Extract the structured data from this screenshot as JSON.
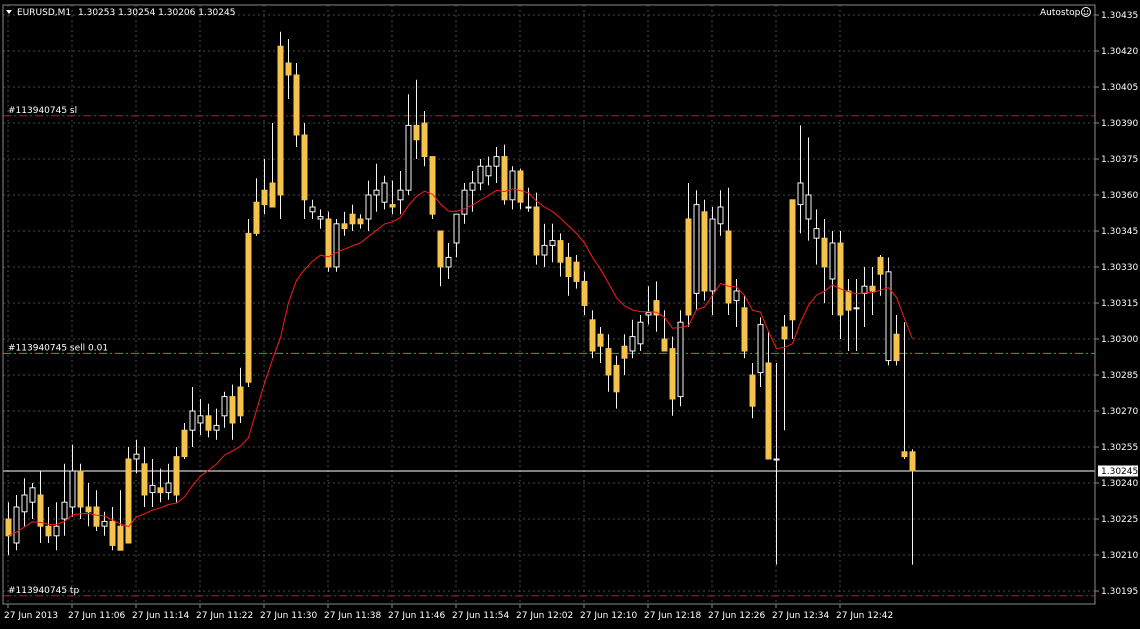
{
  "header": {
    "symbol": "EURUSD,M1",
    "ohlc": "1.30253 1.30254 1.30206 1.30245",
    "autostop_label": "Autostop",
    "autostop_icon": "smiley-icon"
  },
  "colors": {
    "background": "#000000",
    "grid": "#4a4a4a",
    "axis_text": "#ffffff",
    "bull_fill": "#000000",
    "bear_fill": "#f3c34c",
    "candle_outline": "#f4f4f4",
    "ma_line": "#ff1a1a",
    "order_line_sl_tp": "#c8102e",
    "order_line_entry": "#27b24a",
    "price_tag_bg": "#ffffff",
    "price_tag_text": "#000000"
  },
  "chart_data": {
    "type": "candlestick",
    "ylim": [
      1.3019,
      1.3044
    ],
    "y_ticks": [
      "1.30435",
      "1.30420",
      "1.30405",
      "1.30390",
      "1.30375",
      "1.30360",
      "1.30345",
      "1.30330",
      "1.30315",
      "1.30300",
      "1.30285",
      "1.30270",
      "1.30255",
      "1.30240",
      "1.30225",
      "1.30210",
      "1.30195"
    ],
    "x_ticks": [
      "27 Jun 2013",
      "27 Jun 11:06",
      "27 Jun 11:14",
      "27 Jun 11:22",
      "27 Jun 11:30",
      "27 Jun 11:38",
      "27 Jun 11:46",
      "27 Jun 11:54",
      "27 Jun 12:02",
      "27 Jun 12:10",
      "27 Jun 12:18",
      "27 Jun 12:26",
      "27 Jun 12:34",
      "27 Jun 12:42"
    ],
    "current_price": "1.30245",
    "order_lines": [
      {
        "label": "#113940745 sl",
        "price": 1.30393,
        "kind": "sl"
      },
      {
        "label": "#113940745 sell 0.01",
        "price": 1.30294,
        "kind": "entry"
      },
      {
        "label": "#113940745 tp",
        "price": 1.30193,
        "kind": "tp"
      }
    ],
    "candles": [
      {
        "o": 1.30225,
        "h": 1.30232,
        "l": 1.3021,
        "c": 1.30218
      },
      {
        "o": 1.30215,
        "h": 1.30235,
        "l": 1.30212,
        "c": 1.3023
      },
      {
        "o": 1.30228,
        "h": 1.30242,
        "l": 1.30222,
        "c": 1.30235
      },
      {
        "o": 1.30232,
        "h": 1.3024,
        "l": 1.30225,
        "c": 1.30238
      },
      {
        "o": 1.30235,
        "h": 1.30245,
        "l": 1.30215,
        "c": 1.30222
      },
      {
        "o": 1.30222,
        "h": 1.3023,
        "l": 1.30215,
        "c": 1.30218
      },
      {
        "o": 1.30218,
        "h": 1.30232,
        "l": 1.30212,
        "c": 1.30222
      },
      {
        "o": 1.30225,
        "h": 1.30248,
        "l": 1.30218,
        "c": 1.30232
      },
      {
        "o": 1.3023,
        "h": 1.30256,
        "l": 1.30226,
        "c": 1.30245
      },
      {
        "o": 1.30245,
        "h": 1.30248,
        "l": 1.30225,
        "c": 1.3023
      },
      {
        "o": 1.3023,
        "h": 1.3024,
        "l": 1.30222,
        "c": 1.30228
      },
      {
        "o": 1.3023,
        "h": 1.30237,
        "l": 1.3022,
        "c": 1.30222
      },
      {
        "o": 1.30222,
        "h": 1.30228,
        "l": 1.30218,
        "c": 1.30224
      },
      {
        "o": 1.30224,
        "h": 1.3023,
        "l": 1.30212,
        "c": 1.30214
      },
      {
        "o": 1.30222,
        "h": 1.30237,
        "l": 1.30212,
        "c": 1.30212
      },
      {
        "o": 1.3025,
        "h": 1.30255,
        "l": 1.30215,
        "c": 1.30215
      },
      {
        "o": 1.3025,
        "h": 1.30258,
        "l": 1.30244,
        "c": 1.30252
      },
      {
        "o": 1.30248,
        "h": 1.30255,
        "l": 1.3023,
        "c": 1.30235
      },
      {
        "o": 1.30236,
        "h": 1.3025,
        "l": 1.3023,
        "c": 1.30239
      },
      {
        "o": 1.30238,
        "h": 1.30246,
        "l": 1.30232,
        "c": 1.30236
      },
      {
        "o": 1.30236,
        "h": 1.30248,
        "l": 1.30233,
        "c": 1.3024
      },
      {
        "o": 1.30251,
        "h": 1.30255,
        "l": 1.30232,
        "c": 1.30235
      },
      {
        "o": 1.30262,
        "h": 1.30265,
        "l": 1.3025,
        "c": 1.30251
      },
      {
        "o": 1.30262,
        "h": 1.3028,
        "l": 1.30255,
        "c": 1.3027
      },
      {
        "o": 1.30265,
        "h": 1.30275,
        "l": 1.3026,
        "c": 1.30268
      },
      {
        "o": 1.30268,
        "h": 1.30273,
        "l": 1.30259,
        "c": 1.30262
      },
      {
        "o": 1.30262,
        "h": 1.30271,
        "l": 1.30258,
        "c": 1.30264
      },
      {
        "o": 1.30268,
        "h": 1.30278,
        "l": 1.30263,
        "c": 1.30276
      },
      {
        "o": 1.30276,
        "h": 1.30281,
        "l": 1.30258,
        "c": 1.30265
      },
      {
        "o": 1.3028,
        "h": 1.30288,
        "l": 1.30265,
        "c": 1.30268
      },
      {
        "o": 1.30344,
        "h": 1.3035,
        "l": 1.3028,
        "c": 1.30282
      },
      {
        "o": 1.30357,
        "h": 1.30367,
        "l": 1.30343,
        "c": 1.30344
      },
      {
        "o": 1.30362,
        "h": 1.30375,
        "l": 1.30352,
        "c": 1.30356
      },
      {
        "o": 1.30365,
        "h": 1.3039,
        "l": 1.30355,
        "c": 1.30355
      },
      {
        "o": 1.30422,
        "h": 1.30428,
        "l": 1.3035,
        "c": 1.3036
      },
      {
        "o": 1.30415,
        "h": 1.30425,
        "l": 1.304,
        "c": 1.3041
      },
      {
        "o": 1.3041,
        "h": 1.30415,
        "l": 1.3038,
        "c": 1.30385
      },
      {
        "o": 1.30385,
        "h": 1.3039,
        "l": 1.3035,
        "c": 1.30358
      },
      {
        "o": 1.30353,
        "h": 1.30358,
        "l": 1.3035,
        "c": 1.30355
      },
      {
        "o": 1.3035,
        "h": 1.30354,
        "l": 1.30346,
        "c": 1.30351
      },
      {
        "o": 1.3035,
        "h": 1.30353,
        "l": 1.30328,
        "c": 1.3033
      },
      {
        "o": 1.3033,
        "h": 1.3035,
        "l": 1.30328,
        "c": 1.30348
      },
      {
        "o": 1.30348,
        "h": 1.30353,
        "l": 1.30343,
        "c": 1.30346
      },
      {
        "o": 1.30352,
        "h": 1.30356,
        "l": 1.30345,
        "c": 1.30348
      },
      {
        "o": 1.3035,
        "h": 1.30352,
        "l": 1.30346,
        "c": 1.30348
      },
      {
        "o": 1.3035,
        "h": 1.30366,
        "l": 1.30345,
        "c": 1.3036
      },
      {
        "o": 1.3036,
        "h": 1.30373,
        "l": 1.30353,
        "c": 1.30362
      },
      {
        "o": 1.30357,
        "h": 1.30368,
        "l": 1.30354,
        "c": 1.30365
      },
      {
        "o": 1.30356,
        "h": 1.30366,
        "l": 1.30352,
        "c": 1.30355
      },
      {
        "o": 1.30358,
        "h": 1.3037,
        "l": 1.30352,
        "c": 1.30362
      },
      {
        "o": 1.30362,
        "h": 1.30402,
        "l": 1.3036,
        "c": 1.30389
      },
      {
        "o": 1.30389,
        "h": 1.30408,
        "l": 1.30375,
        "c": 1.30383
      },
      {
        "o": 1.3039,
        "h": 1.30395,
        "l": 1.30372,
        "c": 1.30376
      },
      {
        "o": 1.30376,
        "h": 1.30376,
        "l": 1.3035,
        "c": 1.30352
      },
      {
        "o": 1.30345,
        "h": 1.30345,
        "l": 1.30322,
        "c": 1.3033
      },
      {
        "o": 1.3033,
        "h": 1.3034,
        "l": 1.30325,
        "c": 1.30334
      },
      {
        "o": 1.3034,
        "h": 1.30351,
        "l": 1.30334,
        "c": 1.30352
      },
      {
        "o": 1.30352,
        "h": 1.30365,
        "l": 1.30348,
        "c": 1.30362
      },
      {
        "o": 1.30362,
        "h": 1.3037,
        "l": 1.30353,
        "c": 1.30365
      },
      {
        "o": 1.30365,
        "h": 1.30375,
        "l": 1.30362,
        "c": 1.30372
      },
      {
        "o": 1.30368,
        "h": 1.30376,
        "l": 1.30364,
        "c": 1.30372
      },
      {
        "o": 1.30372,
        "h": 1.3038,
        "l": 1.30365,
        "c": 1.30376
      },
      {
        "o": 1.30376,
        "h": 1.30381,
        "l": 1.30356,
        "c": 1.30358
      },
      {
        "o": 1.30358,
        "h": 1.30372,
        "l": 1.30354,
        "c": 1.3037
      },
      {
        "o": 1.3037,
        "h": 1.30371,
        "l": 1.30354,
        "c": 1.30357
      },
      {
        "o": 1.30355,
        "h": 1.30363,
        "l": 1.30353,
        "c": 1.30355
      },
      {
        "o": 1.30355,
        "h": 1.30361,
        "l": 1.30331,
        "c": 1.30335
      },
      {
        "o": 1.30335,
        "h": 1.30348,
        "l": 1.3033,
        "c": 1.30339
      },
      {
        "o": 1.30339,
        "h": 1.30348,
        "l": 1.30332,
        "c": 1.30341
      },
      {
        "o": 1.30341,
        "h": 1.30344,
        "l": 1.30326,
        "c": 1.30332
      },
      {
        "o": 1.30334,
        "h": 1.3034,
        "l": 1.30318,
        "c": 1.30326
      },
      {
        "o": 1.30332,
        "h": 1.30335,
        "l": 1.30321,
        "c": 1.30324
      },
      {
        "o": 1.30324,
        "h": 1.30328,
        "l": 1.3031,
        "c": 1.30314
      },
      {
        "o": 1.30308,
        "h": 1.30312,
        "l": 1.30292,
        "c": 1.30295
      },
      {
        "o": 1.30302,
        "h": 1.30305,
        "l": 1.3029,
        "c": 1.30297
      },
      {
        "o": 1.30296,
        "h": 1.30302,
        "l": 1.30278,
        "c": 1.30285
      },
      {
        "o": 1.30289,
        "h": 1.30293,
        "l": 1.30271,
        "c": 1.30278
      },
      {
        "o": 1.30297,
        "h": 1.30302,
        "l": 1.30285,
        "c": 1.30292
      },
      {
        "o": 1.30295,
        "h": 1.30308,
        "l": 1.30292,
        "c": 1.30301
      },
      {
        "o": 1.30298,
        "h": 1.3031,
        "l": 1.30295,
        "c": 1.30307
      },
      {
        "o": 1.3031,
        "h": 1.30322,
        "l": 1.30306,
        "c": 1.30311
      },
      {
        "o": 1.30316,
        "h": 1.30324,
        "l": 1.30303,
        "c": 1.3031
      },
      {
        "o": 1.303,
        "h": 1.30312,
        "l": 1.30295,
        "c": 1.30295
      },
      {
        "o": 1.30296,
        "h": 1.30301,
        "l": 1.30268,
        "c": 1.30275
      },
      {
        "o": 1.30276,
        "h": 1.30312,
        "l": 1.30272,
        "c": 1.30307
      },
      {
        "o": 1.3035,
        "h": 1.30365,
        "l": 1.30305,
        "c": 1.3031
      },
      {
        "o": 1.30319,
        "h": 1.30362,
        "l": 1.30312,
        "c": 1.30356
      },
      {
        "o": 1.30353,
        "h": 1.30358,
        "l": 1.30316,
        "c": 1.3032
      },
      {
        "o": 1.3032,
        "h": 1.30355,
        "l": 1.3031,
        "c": 1.3035
      },
      {
        "o": 1.30348,
        "h": 1.30362,
        "l": 1.30343,
        "c": 1.30355
      },
      {
        "o": 1.30345,
        "h": 1.30363,
        "l": 1.3031,
        "c": 1.30315
      },
      {
        "o": 1.30316,
        "h": 1.30325,
        "l": 1.30305,
        "c": 1.3032
      },
      {
        "o": 1.30313,
        "h": 1.30318,
        "l": 1.30292,
        "c": 1.30295
      },
      {
        "o": 1.30285,
        "h": 1.3029,
        "l": 1.30267,
        "c": 1.30272
      },
      {
        "o": 1.30286,
        "h": 1.30309,
        "l": 1.3028,
        "c": 1.30306
      },
      {
        "o": 1.3029,
        "h": 1.30303,
        "l": 1.3025,
        "c": 1.3025
      },
      {
        "o": 1.3025,
        "h": 1.3029,
        "l": 1.30206,
        "c": 1.3025
      },
      {
        "o": 1.30305,
        "h": 1.3031,
        "l": 1.30262,
        "c": 1.303
      },
      {
        "o": 1.30358,
        "h": 1.30358,
        "l": 1.303,
        "c": 1.30308
      },
      {
        "o": 1.30356,
        "h": 1.30389,
        "l": 1.30344,
        "c": 1.30365
      },
      {
        "o": 1.3035,
        "h": 1.30384,
        "l": 1.30341,
        "c": 1.3036
      },
      {
        "o": 1.30342,
        "h": 1.30354,
        "l": 1.30331,
        "c": 1.30346
      },
      {
        "o": 1.30342,
        "h": 1.3035,
        "l": 1.30315,
        "c": 1.3033
      },
      {
        "o": 1.30325,
        "h": 1.30345,
        "l": 1.3031,
        "c": 1.3034
      },
      {
        "o": 1.3034,
        "h": 1.30345,
        "l": 1.303,
        "c": 1.3031
      },
      {
        "o": 1.3032,
        "h": 1.30325,
        "l": 1.30295,
        "c": 1.30312
      },
      {
        "o": 1.30313,
        "h": 1.30325,
        "l": 1.30295,
        "c": 1.30313
      },
      {
        "o": 1.30319,
        "h": 1.3033,
        "l": 1.30305,
        "c": 1.30322
      },
      {
        "o": 1.30322,
        "h": 1.3033,
        "l": 1.3031,
        "c": 1.3032
      },
      {
        "o": 1.30334,
        "h": 1.30335,
        "l": 1.30318,
        "c": 1.30327
      },
      {
        "o": 1.30291,
        "h": 1.30334,
        "l": 1.30289,
        "c": 1.30328
      },
      {
        "o": 1.30302,
        "h": 1.3031,
        "l": 1.30289,
        "c": 1.30291
      },
      {
        "o": 1.30253,
        "h": 1.30307,
        "l": 1.3025,
        "c": 1.30251
      },
      {
        "o": 1.30253,
        "h": 1.30254,
        "l": 1.30206,
        "c": 1.30245
      }
    ]
  }
}
